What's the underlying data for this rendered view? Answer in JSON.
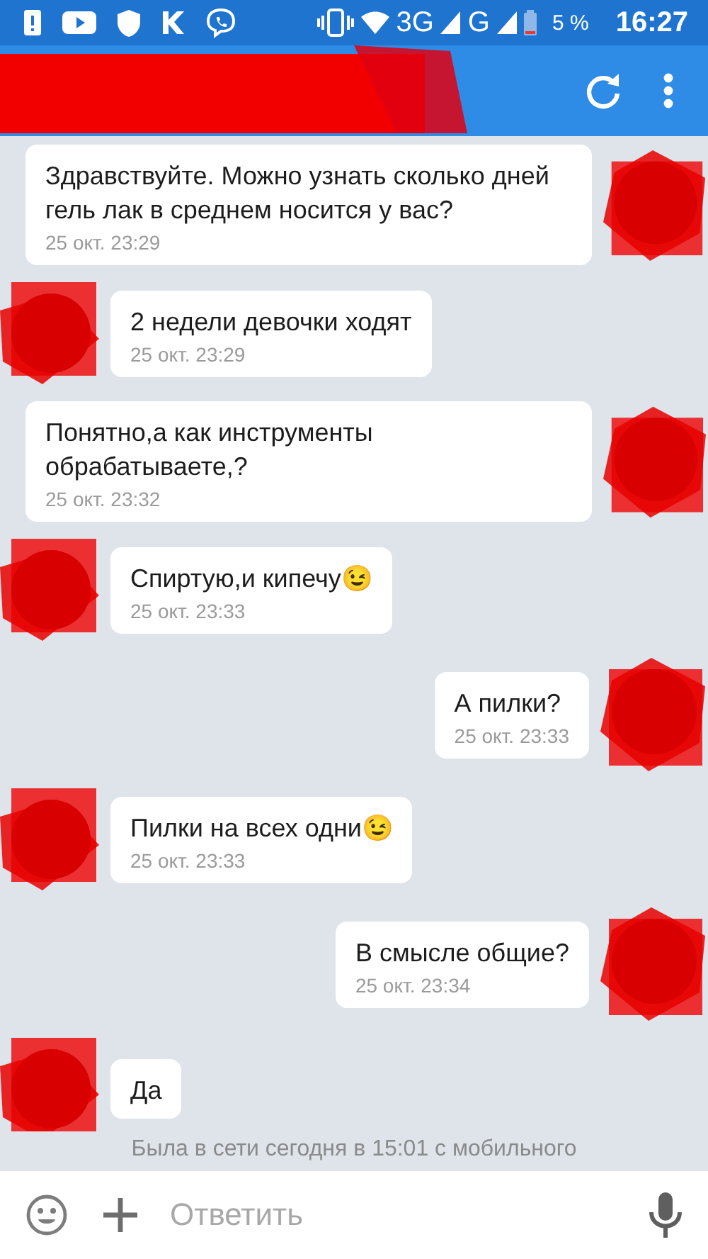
{
  "status_bar": {
    "network": "3G",
    "network_2": "G",
    "battery": "5 %",
    "time": "16:27"
  },
  "messages": [
    {
      "kind": "outgoing",
      "text": "Здравствуйте. Можно узнать сколько дней гель лак в среднем носится у вас?",
      "time": "25 окт. 23:29"
    },
    {
      "kind": "incoming",
      "text": "2 недели девочки ходят",
      "time": "25 окт. 23:29"
    },
    {
      "kind": "outgoing",
      "text": "Понятно,а как инструменты обрабатываете,?",
      "time": "25 окт. 23:32"
    },
    {
      "kind": "incoming",
      "text": "Спиртую,и кипечу😉",
      "time": "25 окт. 23:33"
    },
    {
      "kind": "outgoing",
      "text": "А пилки?",
      "time": "25 окт. 23:33"
    },
    {
      "kind": "incoming",
      "text": "Пилки на всех одни😉",
      "time": "25 окт. 23:33"
    },
    {
      "kind": "outgoing",
      "text": "В смысле общие?",
      "time": "25 окт. 23:34"
    },
    {
      "kind": "incoming",
      "text": "Да"
    }
  ],
  "last_seen": "Была в сети сегодня в 15:01 с мобильного",
  "composer": {
    "placeholder": "Ответить"
  }
}
